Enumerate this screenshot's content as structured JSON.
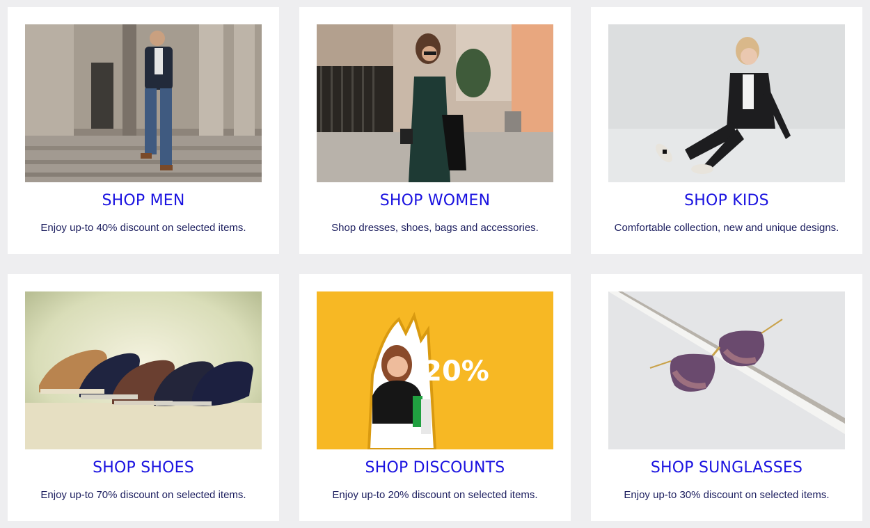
{
  "colors": {
    "page_background": "#eeeef0",
    "card_background": "#ffffff",
    "title": "#1a12e0",
    "description": "#1b1d5e"
  },
  "categories": [
    {
      "title": "SHOP MEN",
      "description": "Enjoy up-to 40% discount on selected items.",
      "image": "man-in-suit-on-steps-photo"
    },
    {
      "title": "SHOP WOMEN",
      "description": "Shop dresses, shoes, bags and accessories.",
      "image": "woman-in-green-dress-street-photo"
    },
    {
      "title": "SHOP KIDS",
      "description": "Comfortable collection, new and unique designs.",
      "image": "child-sitting-studio-photo"
    },
    {
      "title": "SHOP SHOES",
      "description": "Enjoy up-to 70% discount on selected items.",
      "image": "row-of-sneakers-photo"
    },
    {
      "title": "SHOP DISCOUNTS",
      "description": "Enjoy up-to 20% discount on selected items.",
      "image": "woman-through-yellow-paper-photo",
      "badge_text": "20%"
    },
    {
      "title": "SHOP SUNGLASSES",
      "description": "Enjoy up-to 30% discount on selected items.",
      "image": "sunglasses-product-photo"
    }
  ]
}
